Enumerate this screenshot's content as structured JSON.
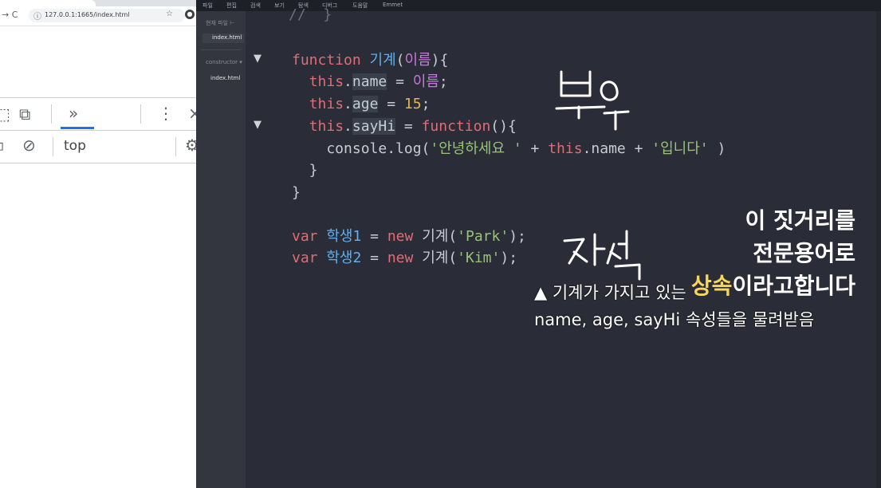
{
  "browser": {
    "url": "127.0.0.1:1665/index.html",
    "devtools": {
      "more_tabs_label": "»",
      "context_label": "top"
    }
  },
  "editor": {
    "menu": [
      "파일",
      "편집",
      "검색",
      "보기",
      "탐색",
      "디버그",
      "도움말",
      "Emmet"
    ],
    "sidebar": {
      "section_title": "현재 파일",
      "files": [
        "index.html"
      ],
      "project_label": "constructor",
      "project_files": [
        "index.html"
      ]
    },
    "code_lines": [
      [
        {
          "c": "cm",
          "t": "//  }"
        }
      ],
      [
        {
          "c": "kw",
          "t": "function "
        },
        {
          "c": "fn",
          "t": "기계"
        },
        {
          "c": "pl",
          "t": "("
        },
        {
          "c": "pm",
          "t": "이름"
        },
        {
          "c": "pl",
          "t": "){"
        }
      ],
      [
        {
          "c": "pl",
          "t": "  "
        },
        {
          "c": "kw",
          "t": "this"
        },
        {
          "c": "pl",
          "t": "."
        },
        {
          "c": "hl",
          "t": "name"
        },
        {
          "c": "pl",
          "t": " = "
        },
        {
          "c": "pm",
          "t": "이름"
        },
        {
          "c": "pl",
          "t": ";"
        }
      ],
      [
        {
          "c": "pl",
          "t": "  "
        },
        {
          "c": "kw",
          "t": "this"
        },
        {
          "c": "pl",
          "t": "."
        },
        {
          "c": "hl",
          "t": "age"
        },
        {
          "c": "pl",
          "t": " = "
        },
        {
          "c": "num",
          "t": "15"
        },
        {
          "c": "pl",
          "t": ";"
        }
      ],
      [
        {
          "c": "pl",
          "t": "  "
        },
        {
          "c": "kw",
          "t": "this"
        },
        {
          "c": "pl",
          "t": "."
        },
        {
          "c": "hl",
          "t": "sayHi"
        },
        {
          "c": "pl",
          "t": " = "
        },
        {
          "c": "kw",
          "t": "function"
        },
        {
          "c": "pl",
          "t": "(){"
        }
      ],
      [
        {
          "c": "pl",
          "t": "    console.log("
        },
        {
          "c": "str",
          "t": "'안녕하세요 '"
        },
        {
          "c": "pl",
          "t": " + "
        },
        {
          "c": "kw",
          "t": "this"
        },
        {
          "c": "pl",
          "t": ".name + "
        },
        {
          "c": "str",
          "t": "'입니다'"
        },
        {
          "c": "pl",
          "t": " )"
        }
      ],
      [
        {
          "c": "pl",
          "t": "  }"
        }
      ],
      [
        {
          "c": "pl",
          "t": "}"
        }
      ],
      [],
      [
        {
          "c": "kw",
          "t": "var "
        },
        {
          "c": "fn",
          "t": "학생1"
        },
        {
          "c": "pl",
          "t": " = "
        },
        {
          "c": "kw",
          "t": "new "
        },
        {
          "c": "pl",
          "t": "기계("
        },
        {
          "c": "str",
          "t": "'Park'"
        },
        {
          "c": "pl",
          "t": ");"
        }
      ],
      [
        {
          "c": "kw",
          "t": "var "
        },
        {
          "c": "fn",
          "t": "학생2"
        },
        {
          "c": "pl",
          "t": " = "
        },
        {
          "c": "kw",
          "t": "new "
        },
        {
          "c": "pl",
          "t": "기계("
        },
        {
          "c": "str",
          "t": "'Kim'"
        },
        {
          "c": "pl",
          "t": ");"
        }
      ]
    ],
    "fold_markers": [
      "▼",
      "▼"
    ]
  },
  "annotations": {
    "caption_line1": "▲ 기계가 가지고 있는",
    "caption_line2": "name, age, sayHi 속성들을 물려받음",
    "note_line1": "이 짓거리를",
    "note_line2": "전문용어로",
    "note_line3_highlight": "상속",
    "note_line3_rest": "이라고합니다",
    "handwriting_parent": "부모",
    "handwriting_child": "자식"
  }
}
